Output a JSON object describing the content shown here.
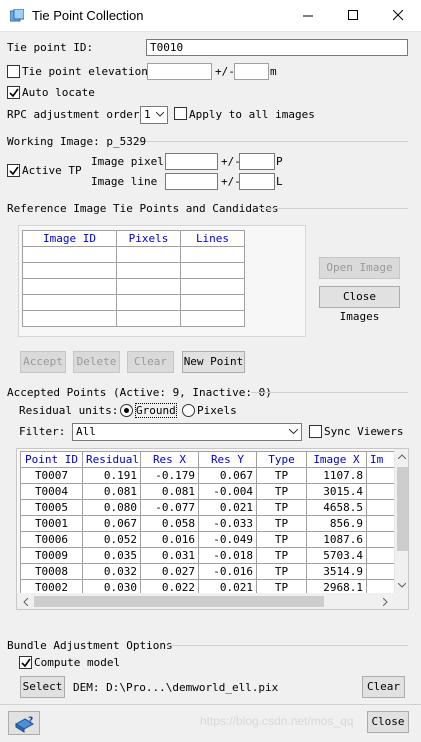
{
  "window": {
    "title": "Tie Point Collection"
  },
  "tie_point_id": {
    "label": "Tie point ID:",
    "value": "T0010"
  },
  "elevation": {
    "label": "Tie point elevation:",
    "checked": false,
    "value": "",
    "plusminus": "+/-",
    "tolerance": "",
    "unit": "m"
  },
  "auto_locate": {
    "label": "Auto locate",
    "checked": true
  },
  "rpc": {
    "label": "RPC adjustment order:",
    "value": "1",
    "apply_label": "Apply to all images",
    "apply_checked": false
  },
  "working_image": {
    "header": "Working Image: p_5329",
    "active_tp_label": "Active TP",
    "active_tp_checked": true,
    "pixel_label": "Image pixel:",
    "line_label": "Image line :",
    "plusminus": "+/-",
    "pixel_unit": "P",
    "line_unit": "L",
    "pixel_value": "",
    "pixel_tol": "",
    "line_value": "",
    "line_tol": ""
  },
  "reference": {
    "header": "Reference Image Tie Points and Candidates",
    "columns": [
      "Image ID",
      "Pixels",
      "Lines"
    ],
    "open_images": "Open Image",
    "close_images": "Close Images"
  },
  "actions": {
    "accept": "Accept",
    "delete": "Delete",
    "clear": "Clear",
    "new_point": "New Point"
  },
  "accepted": {
    "header": "Accepted Points (Active: 9, Inactive: 0)",
    "residual_units_label": "Residual units:",
    "ground_label": "Ground",
    "pixels_label": "Pixels",
    "selected_unit": "Ground",
    "filter_label": "Filter:",
    "filter_value": "All",
    "sync_label": "Sync Viewers",
    "sync_checked": false,
    "columns": [
      "Point ID",
      "Residual",
      "Res X",
      "Res Y",
      "Type",
      "Image X",
      "Im"
    ],
    "rows": [
      [
        "T0007",
        "0.191",
        "-0.179",
        "0.067",
        "TP",
        "1107.8"
      ],
      [
        "T0004",
        "0.081",
        "0.081",
        "-0.004",
        "TP",
        "3015.4"
      ],
      [
        "T0005",
        "0.080",
        "-0.077",
        "0.021",
        "TP",
        "4658.5"
      ],
      [
        "T0001",
        "0.067",
        "0.058",
        "-0.033",
        "TP",
        "856.9"
      ],
      [
        "T0006",
        "0.052",
        "0.016",
        "-0.049",
        "TP",
        "1087.6"
      ],
      [
        "T0009",
        "0.035",
        "0.031",
        "-0.018",
        "TP",
        "5703.4"
      ],
      [
        "T0008",
        "0.032",
        "0.027",
        "-0.016",
        "TP",
        "3514.9"
      ],
      [
        "T0002",
        "0.030",
        "0.022",
        "0.021",
        "TP",
        "2968.1"
      ]
    ]
  },
  "bundle": {
    "header": "Bundle Adjustment Options",
    "compute_label": "Compute model",
    "compute_checked": true,
    "select_label": "Select",
    "dem_text": "DEM: D:\\Pro...\\demworld_ell.pix",
    "clear_label": "Clear"
  },
  "footer": {
    "close_label": "Close",
    "watermark": "https://blog.csdn.net/mos_qq"
  }
}
